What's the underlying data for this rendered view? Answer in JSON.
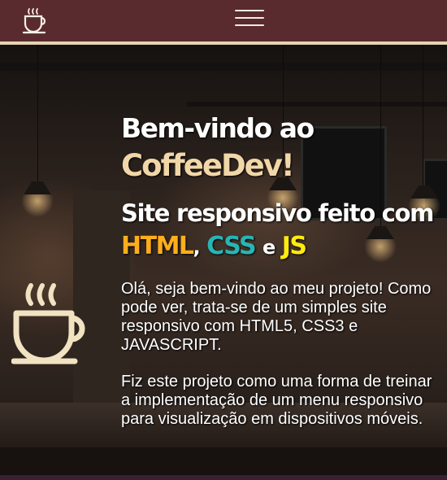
{
  "header": {
    "logo_icon": "coffee-cup-icon",
    "menu_icon": "hamburger-menu-icon"
  },
  "hero": {
    "background": "coffee-shop-photo",
    "side_icon": "coffee-cup-icon",
    "title_line1": "Bem-vindo ao",
    "title_line2": "CoffeeDev!",
    "subtitle": "Site responsivo feito com",
    "tech": {
      "html": "HTML",
      "comma": ",",
      "css": "CSS",
      "and": "e",
      "js": "JS"
    },
    "paragraph1": " Olá, seja bem-vindo ao meu projeto! Como pode ver, trata-se de um simples site responsivo com HTML5, CSS3 e JAVASCRIPT.",
    "paragraph2": " Fiz este projeto como uma forma de treinar a implementação de um menu responsivo para visualização em dispositivos móveis."
  },
  "colors": {
    "header_bg": "#5a2b2e",
    "accent_cream": "#f1d7a8",
    "html": "#ffae1b",
    "css": "#27b5b5",
    "js": "#ffeb0f"
  }
}
